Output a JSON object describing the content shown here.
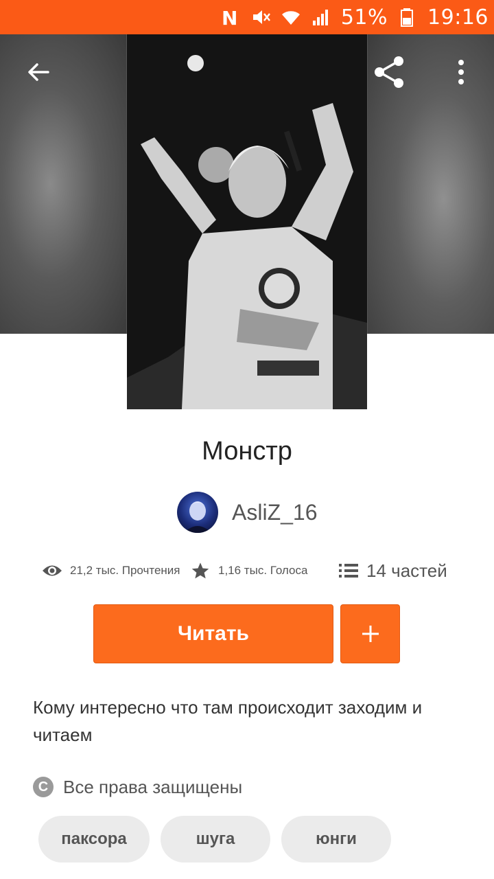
{
  "status_bar": {
    "battery": "51%",
    "time": "19:16",
    "icons": [
      "nfc-icon",
      "mute-icon",
      "wifi-icon",
      "signal-icon",
      "battery-icon"
    ]
  },
  "toolbar": {
    "back_icon": "arrow-left-icon",
    "share_icon": "share-icon",
    "menu_icon": "more-vert-icon"
  },
  "story": {
    "title": "Монстр",
    "author": "AsliZ_16",
    "reads": "21,2 тыс. Прочтения",
    "votes": "1,16 тыс. Голоса",
    "parts": "14 частей",
    "read_button": "Читать",
    "add_button_icon": "plus-icon",
    "description": "Кому интересно что там происходит заходим и читаем",
    "copyright": "Все права защищены",
    "tags": [
      "паксора",
      "шуга",
      "юнги"
    ]
  },
  "colors": {
    "accent": "#fc6b1d",
    "status_bar": "#fb5a16",
    "tag_bg": "#ebebeb"
  }
}
